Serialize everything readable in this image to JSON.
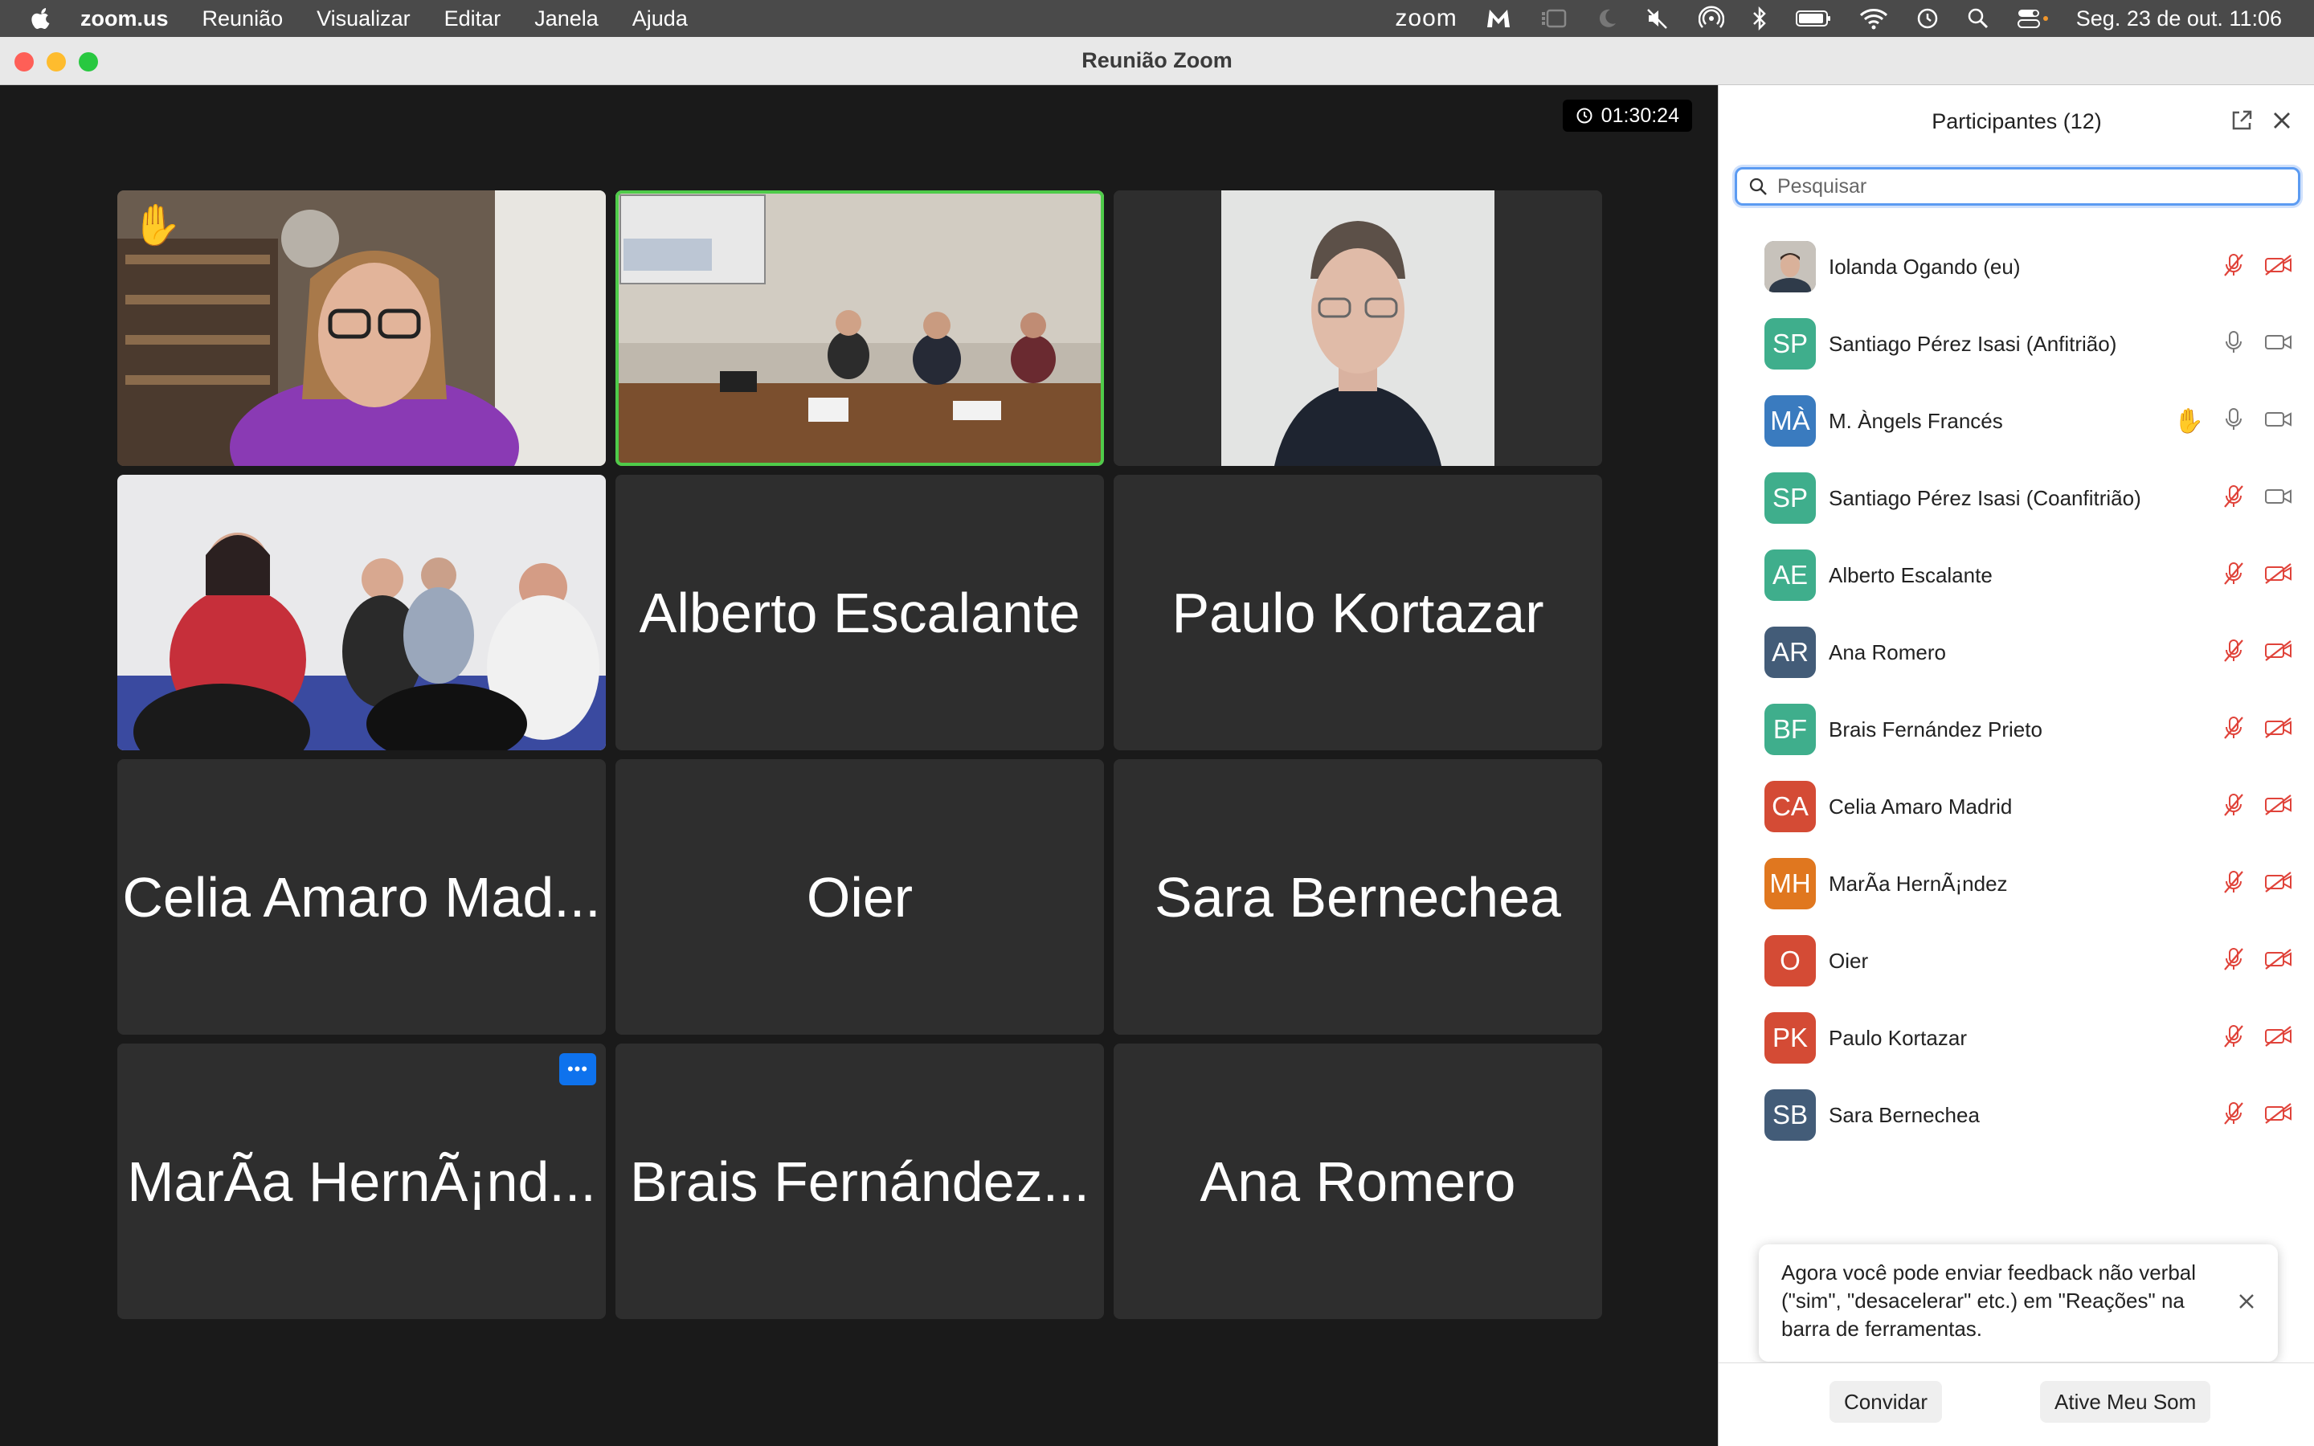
{
  "menubar": {
    "app": "zoom.us",
    "items": [
      "Reunião",
      "Visualizar",
      "Editar",
      "Janela",
      "Ajuda"
    ],
    "zoom_logo": "zoom",
    "clock": "Seg. 23 de out.  11:06"
  },
  "window": {
    "title": "Reunião Zoom"
  },
  "meeting": {
    "timer": "01:30:24",
    "tiles": [
      {
        "name": "",
        "type": "video-woman-glasses",
        "raised_hand": true
      },
      {
        "name": "",
        "type": "video-room-panel",
        "active_speaker": true
      },
      {
        "name": "",
        "type": "video-person-portrait"
      },
      {
        "name": "",
        "type": "video-audience"
      },
      {
        "name": "Alberto Escalante"
      },
      {
        "name": "Paulo Kortazar"
      },
      {
        "name": "Celia Amaro Mad..."
      },
      {
        "name": "Oier"
      },
      {
        "name": "Sara Bernechea"
      },
      {
        "name": "MarÃa HernÃ¡nd...",
        "more_button": "•••"
      },
      {
        "name": "Brais Fernández..."
      },
      {
        "name": "Ana Romero"
      }
    ]
  },
  "participants": {
    "title": "Participantes (12)",
    "search_placeholder": "Pesquisar",
    "list": [
      {
        "initials": "",
        "photo": true,
        "name": "Iolanda Ogando (eu)",
        "color": "#8a8a8a",
        "mic": "muted",
        "video": "off"
      },
      {
        "initials": "SP",
        "name": "Santiago Pérez Isasi (Anfitrião)",
        "color": "#3fae8c",
        "mic": "on",
        "video": "on"
      },
      {
        "initials": "MÀ",
        "name": "M. Àngels Francés",
        "color": "#3a7bbf",
        "hand": true,
        "mic": "on",
        "video": "on"
      },
      {
        "initials": "SP",
        "name": "Santiago Pérez Isasi (Coanfitrião)",
        "color": "#3fae8c",
        "mic": "muted",
        "video": "on"
      },
      {
        "initials": "AE",
        "name": "Alberto Escalante",
        "color": "#3fae8c",
        "mic": "muted",
        "video": "off"
      },
      {
        "initials": "AR",
        "name": "Ana Romero",
        "color": "#435c78",
        "mic": "muted",
        "video": "off"
      },
      {
        "initials": "BF",
        "name": "Brais Fernández Prieto",
        "color": "#3fae8c",
        "mic": "muted",
        "video": "off"
      },
      {
        "initials": "CA",
        "name": "Celia Amaro Madrid",
        "color": "#d44b35",
        "mic": "muted",
        "video": "off"
      },
      {
        "initials": "MH",
        "name": "MarÃa HernÃ¡ndez",
        "color": "#e0771f",
        "mic": "muted",
        "video": "off"
      },
      {
        "initials": "O",
        "name": "Oier",
        "color": "#d44b35",
        "mic": "muted",
        "video": "off"
      },
      {
        "initials": "PK",
        "name": "Paulo Kortazar",
        "color": "#d44b35",
        "mic": "muted",
        "video": "off"
      },
      {
        "initials": "SB",
        "name": "Sara Bernechea",
        "color": "#435c78",
        "mic": "muted",
        "video": "off"
      }
    ],
    "toast": "Agora você pode enviar feedback não verbal (\"sim\", \"desacelerar\" etc.) em \"Reações\" na barra de ferramentas.",
    "invite_button": "Convidar",
    "unmute_button": "Ative Meu Som"
  },
  "colors": {
    "accent": "#0e72ed",
    "muted_red": "#e0433a",
    "active_speaker": "#4fcb4a"
  }
}
